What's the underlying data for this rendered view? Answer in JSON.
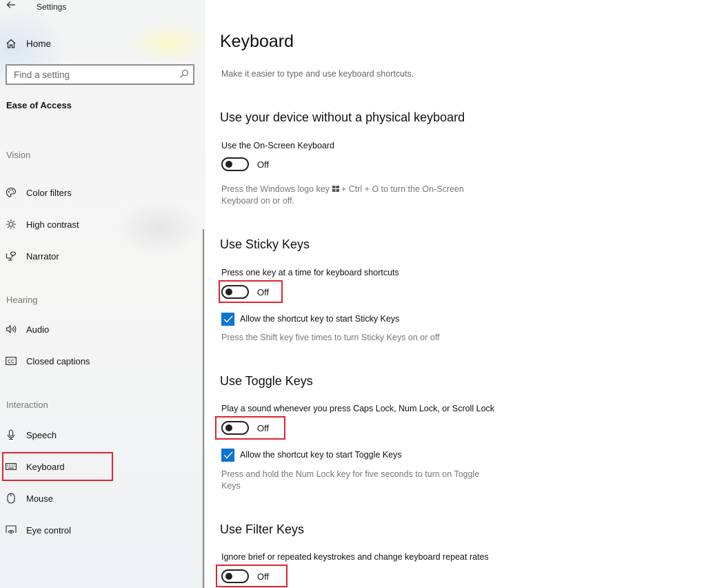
{
  "window": {
    "title": "Settings"
  },
  "sidebar": {
    "home_label": "Home",
    "search_placeholder": "Find a setting",
    "category_title": "Ease of Access",
    "groups": {
      "vision": "Vision",
      "hearing": "Hearing",
      "interaction": "Interaction"
    },
    "items": [
      {
        "label": "Color filters",
        "icon": "palette-icon"
      },
      {
        "label": "High contrast",
        "icon": "brightness-icon"
      },
      {
        "label": "Narrator",
        "icon": "narrator-icon"
      },
      {
        "label": "Audio",
        "icon": "speaker-icon"
      },
      {
        "label": "Closed captions",
        "icon": "closed-captions-icon"
      },
      {
        "label": "Speech",
        "icon": "microphone-icon"
      },
      {
        "label": "Keyboard",
        "icon": "keyboard-icon",
        "selected": true
      },
      {
        "label": "Mouse",
        "icon": "mouse-icon"
      },
      {
        "label": "Eye control",
        "icon": "eye-control-icon"
      }
    ]
  },
  "main": {
    "title": "Keyboard",
    "description": "Make it easier to type and use keyboard shortcuts.",
    "sections": [
      {
        "title": "Use your device without a physical keyboard",
        "setting_label": "Use the On-Screen Keyboard",
        "toggle_state": "Off",
        "help_text_1": "Press the Windows logo key",
        "help_text_2": "+ Ctrl + O to turn the On-Screen Keyboard on or off."
      },
      {
        "title": "Use Sticky Keys",
        "setting_label": "Press one key at a time for keyboard shortcuts",
        "toggle_state": "Off",
        "checkbox_label": "Allow the shortcut key to start Sticky Keys",
        "checkbox_checked": true,
        "help_text": "Press the Shift key five times to turn Sticky Keys on or off"
      },
      {
        "title": "Use Toggle Keys",
        "setting_label": "Play a sound whenever you press Caps Lock, Num Lock, or Scroll Lock",
        "toggle_state": "Off",
        "checkbox_label": "Allow the shortcut key to start Toggle Keys",
        "checkbox_checked": true,
        "help_text": "Press and hold the Num Lock key for five seconds to turn on Toggle Keys"
      },
      {
        "title": "Use Filter Keys",
        "setting_label": "Ignore brief or repeated keystrokes and change keyboard repeat rates",
        "toggle_state": "Off"
      }
    ]
  },
  "colors": {
    "accent": "#0a74d4",
    "highlight": "#e0242e"
  }
}
